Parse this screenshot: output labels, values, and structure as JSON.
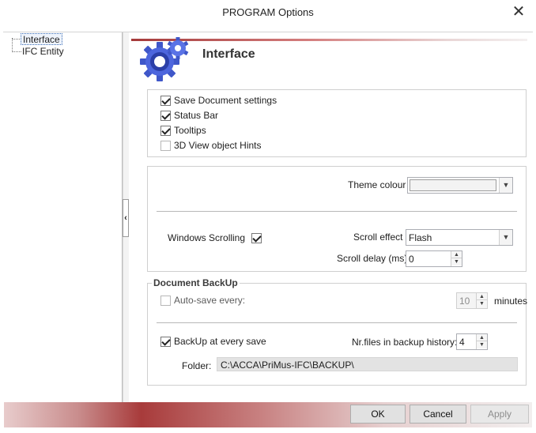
{
  "window": {
    "title": "PROGRAM Options",
    "close_symbol": "✕"
  },
  "tree": {
    "items": [
      {
        "label": "Interface",
        "selected": true
      },
      {
        "label": "IFC Entity",
        "selected": false
      }
    ]
  },
  "splitter": {
    "collapse_symbol": "‹"
  },
  "page": {
    "heading": "Interface",
    "icon": "gears-icon"
  },
  "general": {
    "checkboxes": [
      {
        "label": "Save Document settings",
        "checked": true
      },
      {
        "label": "Status Bar",
        "checked": true
      },
      {
        "label": "Tooltips",
        "checked": true
      },
      {
        "label": "3D View object Hints",
        "checked": false
      }
    ]
  },
  "appearance": {
    "theme_colour_label": "Theme colour",
    "windows_scrolling_label": "Windows Scrolling",
    "windows_scrolling_checked": true,
    "scroll_effect_label": "Scroll effect",
    "scroll_effect_value": "Flash",
    "scroll_delay_label": "Scroll delay (ms)",
    "scroll_delay_value": "0"
  },
  "backup": {
    "group_title": "Document BackUp",
    "autosave_label": "Auto-save every:",
    "autosave_checked": false,
    "autosave_value": "10",
    "minutes_label": "minutes",
    "backup_every_save_label": "BackUp at every save",
    "backup_every_save_checked": true,
    "nr_files_label": "Nr.files in backup history:",
    "nr_files_value": "4",
    "folder_label": "Folder:",
    "folder_value": "C:\\ACCA\\PriMus-IFC\\BACKUP\\"
  },
  "buttons": {
    "ok": "OK",
    "cancel": "Cancel",
    "apply": "Apply"
  },
  "glyphs": {
    "dropdown": "▼",
    "spin_up": "▲",
    "spin_down": "▼"
  }
}
